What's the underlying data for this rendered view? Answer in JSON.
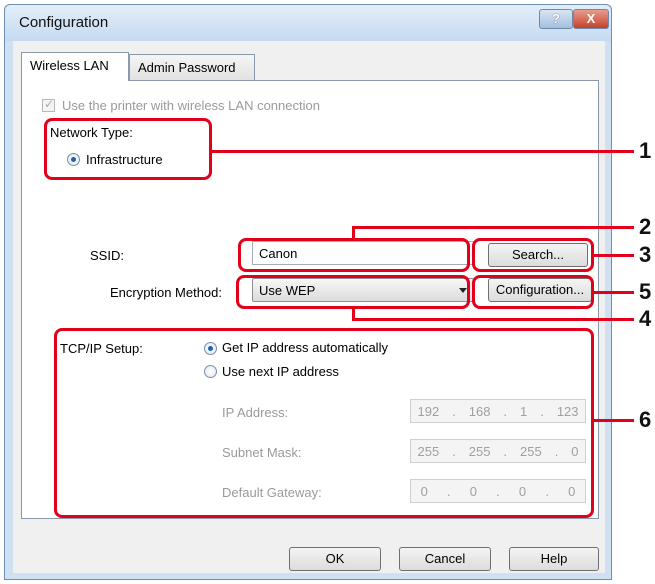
{
  "window": {
    "title": "Configuration",
    "help_label": "?",
    "close_label": "X"
  },
  "tabs": [
    {
      "label": "Wireless LAN"
    },
    {
      "label": "Admin Password"
    }
  ],
  "wireless": {
    "use_printer_label": "Use the printer with wireless LAN connection",
    "network_type_label": "Network Type:",
    "infrastructure_label": "Infrastructure",
    "ssid_label": "SSID:",
    "ssid_value": "Canon",
    "search_label": "Search...",
    "encryption_label": "Encryption Method:",
    "encryption_value": "Use WEP",
    "configuration_label": "Configuration..."
  },
  "tcpip": {
    "label": "TCP/IP Setup:",
    "auto_label": "Get IP address automatically",
    "manual_label": "Use next IP address",
    "ip_label": "IP Address:",
    "ip_value": [
      "192",
      "168",
      "1",
      "123"
    ],
    "subnet_label": "Subnet Mask:",
    "subnet_value": [
      "255",
      "255",
      "255",
      "0"
    ],
    "gateway_label": "Default Gateway:",
    "gateway_value": [
      "0",
      "0",
      "0",
      "0"
    ]
  },
  "buttons": {
    "ok": "OK",
    "cancel": "Cancel",
    "help": "Help"
  },
  "callouts": [
    "1",
    "2",
    "3",
    "4",
    "5",
    "6"
  ],
  "colors": {
    "highlight": "#e3001b",
    "title_bar": "#c5daf1",
    "radio_dot": "#1f5fb8"
  }
}
